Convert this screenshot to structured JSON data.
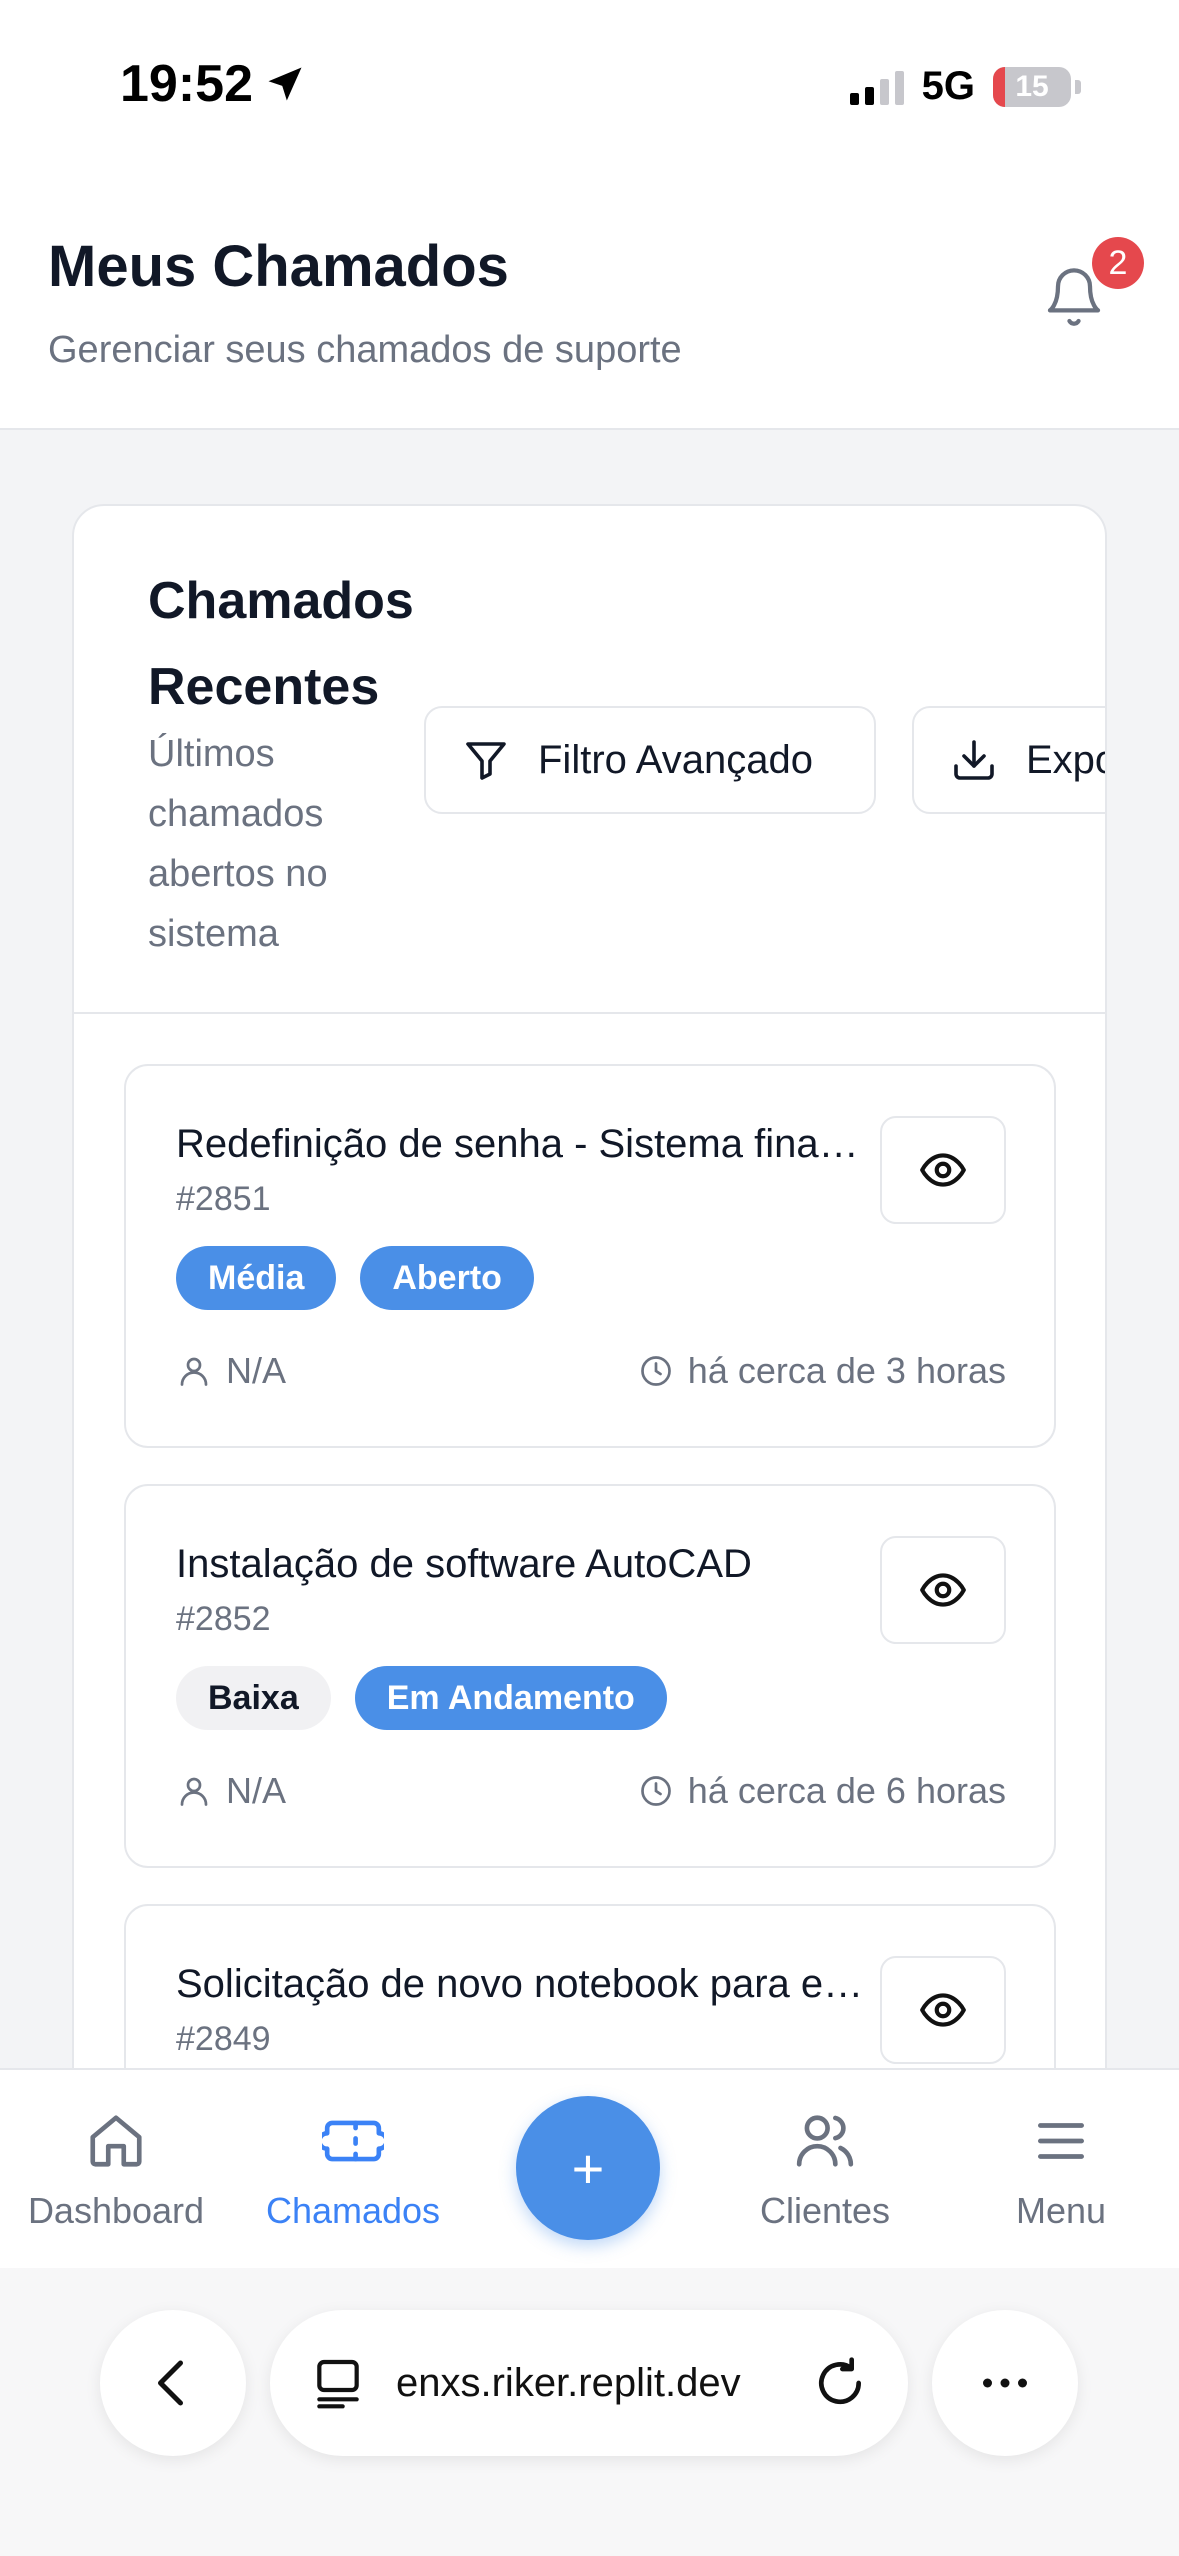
{
  "status_bar": {
    "time": "19:52",
    "network": "5G",
    "battery": "15"
  },
  "header": {
    "title": "Meus Chamados",
    "subtitle": "Gerenciar seus chamados de suporte",
    "notification_count": "2"
  },
  "recent": {
    "title": "Chamados Recentes",
    "description": "Últimos chamados abertos no sistema",
    "filter_label": "Filtro Avançado",
    "export_label": "Exportar"
  },
  "tickets": [
    {
      "title": "Redefinição de senha - Sistema financeiro",
      "id": "#2851",
      "priority": "Média",
      "status": "Aberto",
      "assignee": "N/A",
      "time": "há cerca de 3 horas"
    },
    {
      "title": "Instalação de software AutoCAD",
      "id": "#2852",
      "priority": "Baixa",
      "status": "Em Andamento",
      "assignee": "N/A",
      "time": "há cerca de 6 horas"
    },
    {
      "title": "Solicitação de novo notebook para equipe",
      "id": "#2849"
    }
  ],
  "nav": {
    "dashboard": "Dashboard",
    "chamados": "Chamados",
    "new": "+",
    "clientes": "Clientes",
    "menu": "Menu"
  },
  "browser": {
    "url": "enxs.riker.replit.dev"
  },
  "colors": {
    "accent": "#4a8fe7",
    "badge": "#e5484d",
    "muted": "#6b7280"
  }
}
